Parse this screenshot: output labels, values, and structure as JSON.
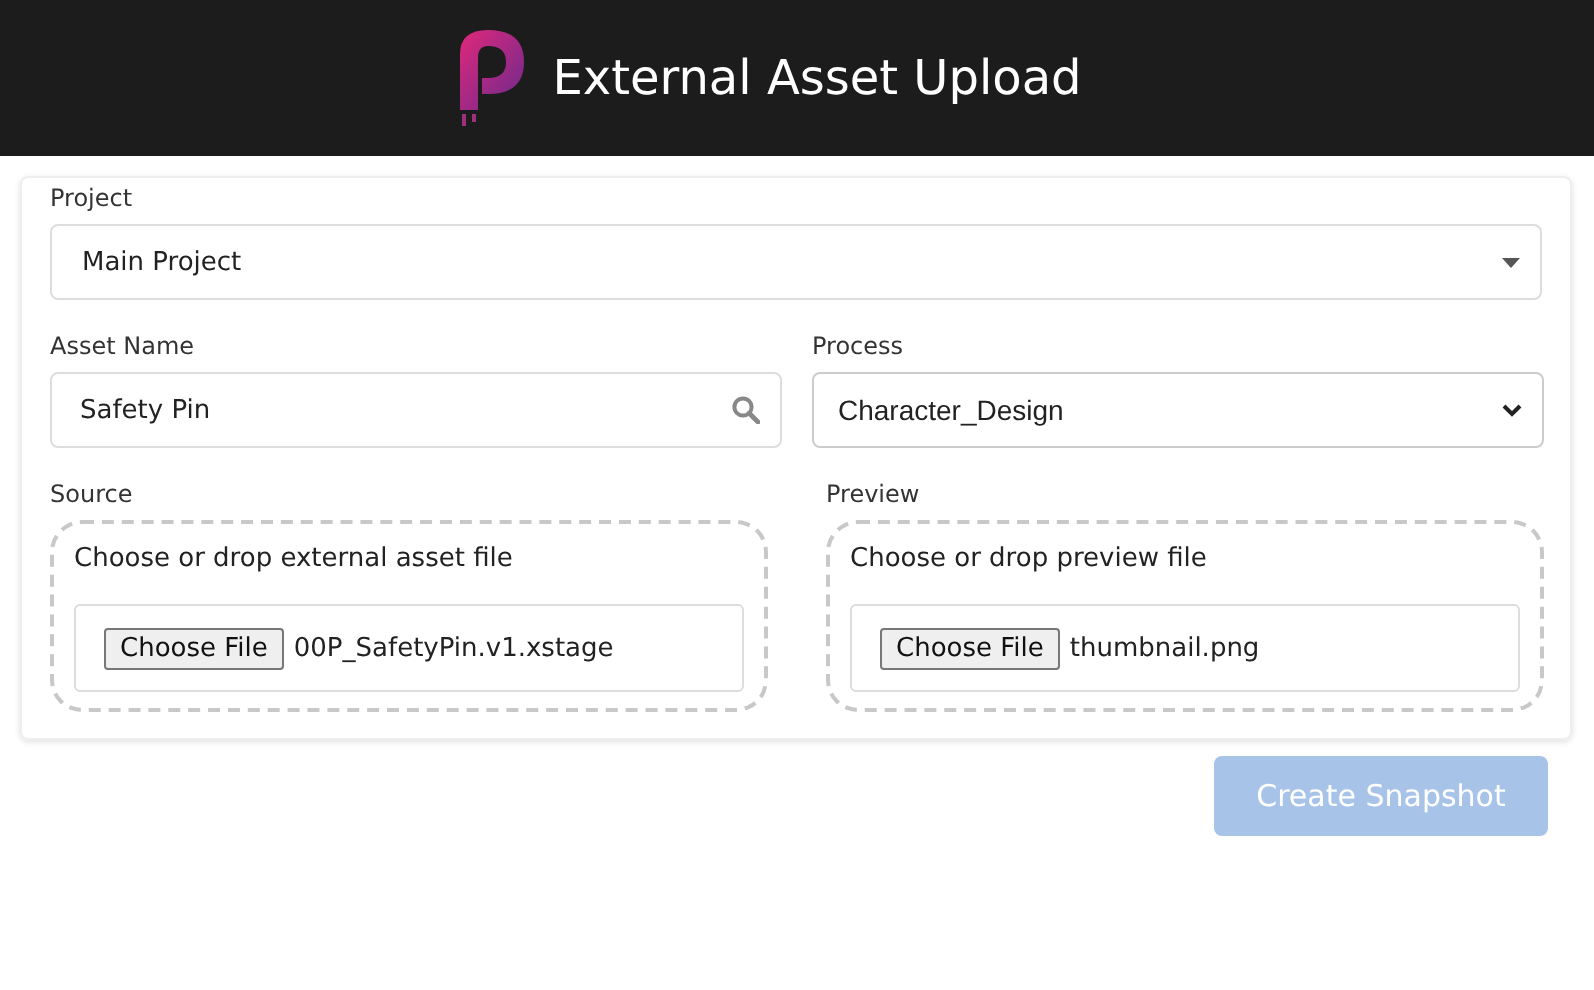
{
  "header": {
    "title": "External Asset Upload"
  },
  "project": {
    "label": "Project",
    "value": "Main Project"
  },
  "asset_name": {
    "label": "Asset Name",
    "value": "Safety Pin"
  },
  "process": {
    "label": "Process",
    "value": "Character_Design"
  },
  "uploads": [
    {
      "label": "Source",
      "prompt": "Choose or drop external asset file",
      "button": "Choose File",
      "file": "00P_SafetyPin.v1.xstage"
    },
    {
      "label": "Preview",
      "prompt": "Choose or drop preview file",
      "button": "Choose File",
      "file": "thumbnail.png"
    }
  ],
  "submit": {
    "label": "Create Snapshot",
    "disabled": true
  }
}
